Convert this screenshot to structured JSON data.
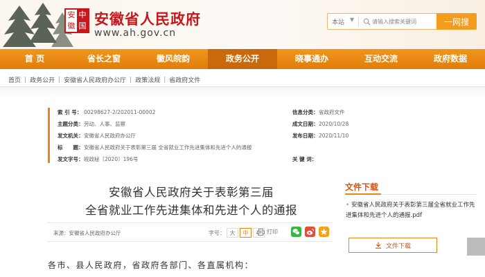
{
  "header": {
    "logo_chars": [
      "安",
      "中",
      "徽",
      "国"
    ],
    "site_title": "安徽省人民政府",
    "site_domain": "www.ah.gov.cn",
    "search": {
      "scope": "本站",
      "placeholder": "请输入搜索关键词",
      "button": "一网搜"
    }
  },
  "nav": {
    "items": [
      "首 页",
      "省长之窗",
      "徽风皖韵",
      "政务公开",
      "晓事通办",
      "互动交流",
      "政府数据"
    ],
    "active_index": 3
  },
  "breadcrumb": [
    "首页",
    "政务公开",
    "安徽省人民政府办公厅",
    "政策法规",
    "省政府文件"
  ],
  "meta": {
    "index_label": "索 引 号：",
    "index_value": "00298627-2/202011-00002",
    "category_label": "信息分类：",
    "category_value": "省政府文件",
    "topic_label": "主题分类：",
    "topic_value": "劳动、人事、监察",
    "created_label": "成文日期：",
    "created_value": "2020/10/28",
    "issuer_label": "发文机关：",
    "issuer_value": "安徽省人民政府办公厅",
    "published_label": "发布日期：",
    "published_value": "2020/11/10",
    "title_label": "标　　题：",
    "title_value": "安徽省人民政府关于表彰第三届 全省就业工作先进集体和先进个人的通报",
    "docno_label": "发文字号：",
    "docno_value": "皖政秘〔2020〕196号",
    "keywords_label": "关 键 词：",
    "keywords_value": ""
  },
  "article": {
    "title_line1": "安徽省人民政府关于表彰第三届",
    "title_line2": "全省就业工作先进集体和先进个人的通报",
    "source": "来源：安徽省人民政府办公厅",
    "font_label": "字号：",
    "font_sizes": [
      "大",
      "中",
      "小"
    ],
    "font_active_index": 1,
    "print_label": "打印",
    "salutation": "各市、县人民政府，省政府各部门、各直属机构："
  },
  "sidebar": {
    "heading": "文件下载",
    "file_name": "安徽省人民政府关于表彰第三届全省就业工作先进集体和先进个人的通报.pdf",
    "download_button": "文件下载"
  },
  "colors": {
    "brand_red": "#c8161d",
    "nav_orange": "#e8860f",
    "accent_orange": "#d9520c"
  }
}
